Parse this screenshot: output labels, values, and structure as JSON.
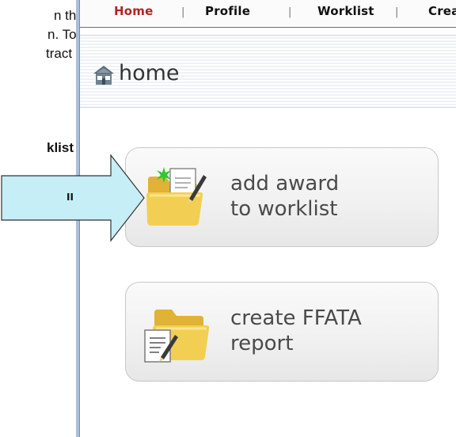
{
  "document": {
    "line1": "n the",
    "line2": "n. To",
    "line3": "tract",
    "line4": "klist"
  },
  "nav": {
    "items": [
      "Home",
      "Profile",
      "Worklist",
      "Crea"
    ],
    "separator": "|"
  },
  "header": {
    "title": "home",
    "icon": "home-icon"
  },
  "tiles": [
    {
      "line1": "add award",
      "line2": "to worklist",
      "icon": "folder-add-icon"
    },
    {
      "line1": "create FFATA",
      "line2": "report",
      "icon": "folder-report-icon"
    }
  ],
  "callout": {
    "label": "II"
  },
  "colors": {
    "nav_active": "#b22222",
    "arrow_fill": "#c6eef6",
    "folder": "#f2cf52"
  }
}
